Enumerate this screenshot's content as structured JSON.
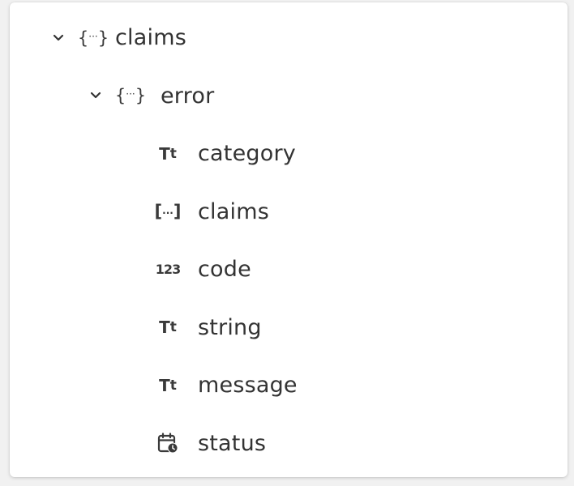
{
  "tree": {
    "root": {
      "label": "claims",
      "icon": "object-icon",
      "expanded": true,
      "child": {
        "label": "error",
        "icon": "object-icon",
        "expanded": true,
        "fields": [
          {
            "label": "category",
            "icon": "text-type-icon"
          },
          {
            "label": "claims",
            "icon": "array-icon"
          },
          {
            "label": "code",
            "icon": "number-type-icon"
          },
          {
            "label": "string",
            "icon": "text-type-icon"
          },
          {
            "label": "message",
            "icon": "text-type-icon"
          },
          {
            "label": "status",
            "icon": "datetime-icon"
          }
        ]
      }
    }
  },
  "colors": {
    "background": "#f1f1f1",
    "panel": "#ffffff",
    "text": "#333333"
  }
}
